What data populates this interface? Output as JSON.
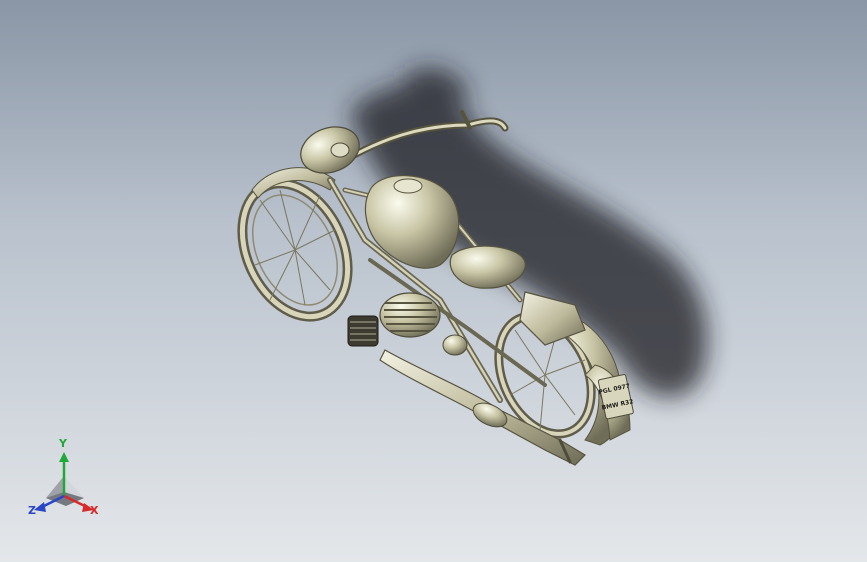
{
  "viewport": {
    "background_top": "#8a96a6",
    "background_bottom": "#e4e7ea",
    "model_color": "#c9c6a6",
    "shadow_color": "#1e1e20"
  },
  "plate": {
    "line1": "PGL 0977",
    "line2": "BMW R32"
  },
  "triad": {
    "y_label": "Y",
    "x_label": "X",
    "z_label": "Z",
    "y_color": "#22a83a",
    "x_color": "#d62a2a",
    "z_color": "#2b45c8"
  }
}
